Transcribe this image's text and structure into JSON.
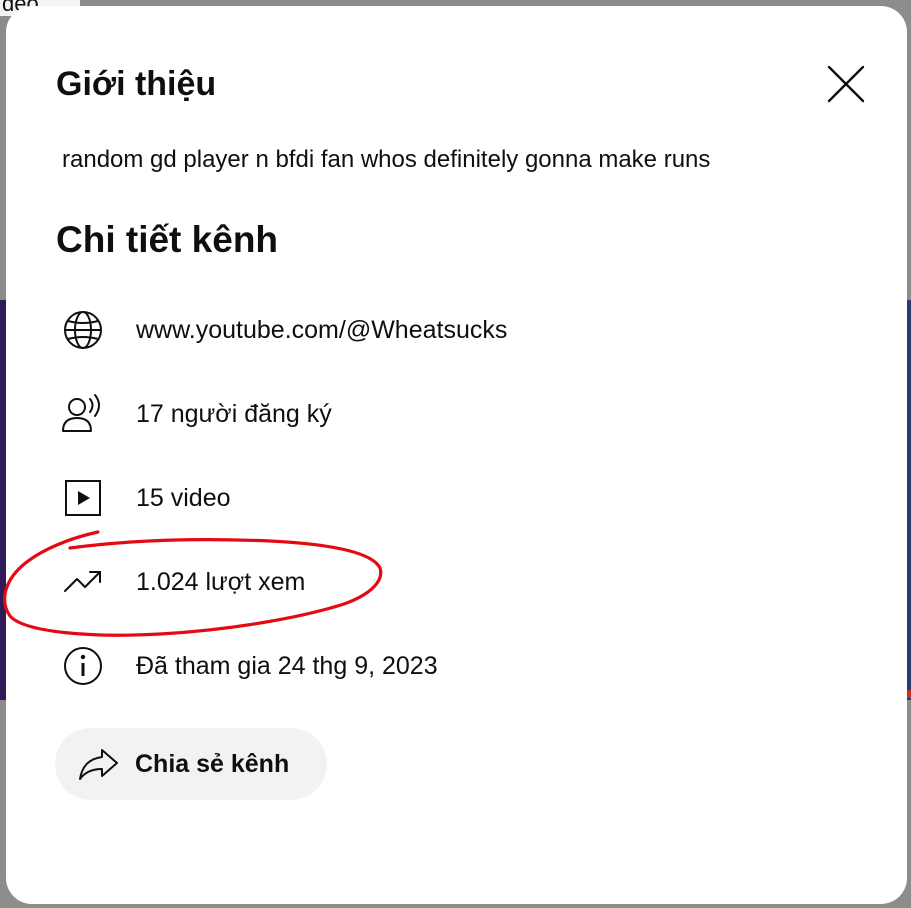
{
  "background": {
    "partial_text": "deo"
  },
  "dialog": {
    "title": "Giới thiệu",
    "close_icon": "close-icon",
    "description": "random gd player n bfdi fan whos definitely gonna make runs",
    "details_title": "Chi tiết kênh",
    "details": {
      "link": {
        "icon": "globe-icon",
        "text": "www.youtube.com/@Wheatsucks"
      },
      "subscribers": {
        "icon": "subscribers-icon",
        "text": "17 người đăng ký"
      },
      "videos": {
        "icon": "video-play-icon",
        "text": "15 video"
      },
      "views": {
        "icon": "trending-up-icon",
        "text": "1.024 lượt xem"
      },
      "joined": {
        "icon": "info-icon",
        "text": "Đã tham gia 24 thg 9, 2023"
      }
    },
    "share_button": {
      "icon": "share-icon",
      "label": "Chia sẻ kênh"
    }
  },
  "colors": {
    "dialog_bg": "#ffffff",
    "text": "#0f0f0f",
    "button_bg": "#f2f2f2",
    "annotation": "#e50914"
  }
}
